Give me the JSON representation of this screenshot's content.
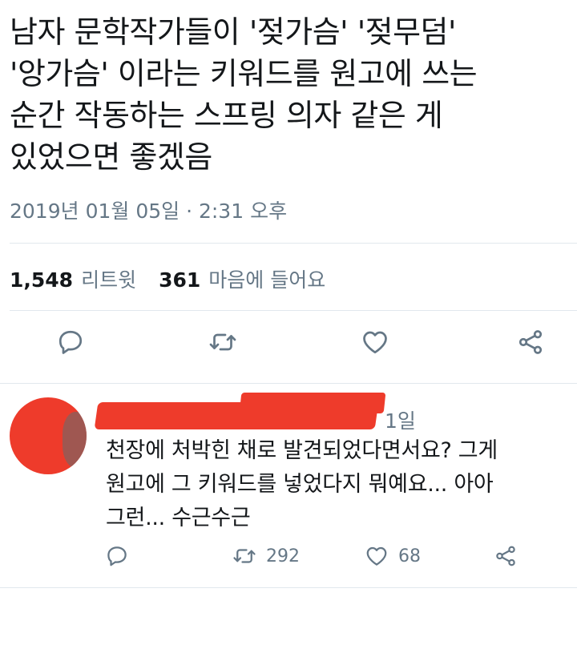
{
  "tweet": {
    "text": "남자 문학작가들이 '젖가슴' '젖무덤'\n'앙가슴' 이라는 키워드를 원고에 쓰는\n순간 작동하는 스프링 의자 같은 게\n있었으면 좋겠음",
    "timestamp": "2019년 01월 05일 · 2:31 오후"
  },
  "stats": {
    "retweets_count": "1,548",
    "retweets_label": "리트윗",
    "likes_count": "361",
    "likes_label": "마음에 들어요"
  },
  "actions": {
    "reply_icon": "reply-icon",
    "retweet_icon": "retweet-icon",
    "like_icon": "heart-icon",
    "share_icon": "share-icon"
  },
  "reply": {
    "time": "1일",
    "text": "천장에 처박힌 채로 발견되었다면서요? 그게\n원고에 그 키워드를 넣었다지 뭐예요... 아아\n그런... 수근수근",
    "retweet_count": "292",
    "like_count": "68"
  },
  "colors": {
    "text": "#14171a",
    "muted": "#657786",
    "divider": "#e1e8ed",
    "redaction": "#ee3b2b"
  }
}
